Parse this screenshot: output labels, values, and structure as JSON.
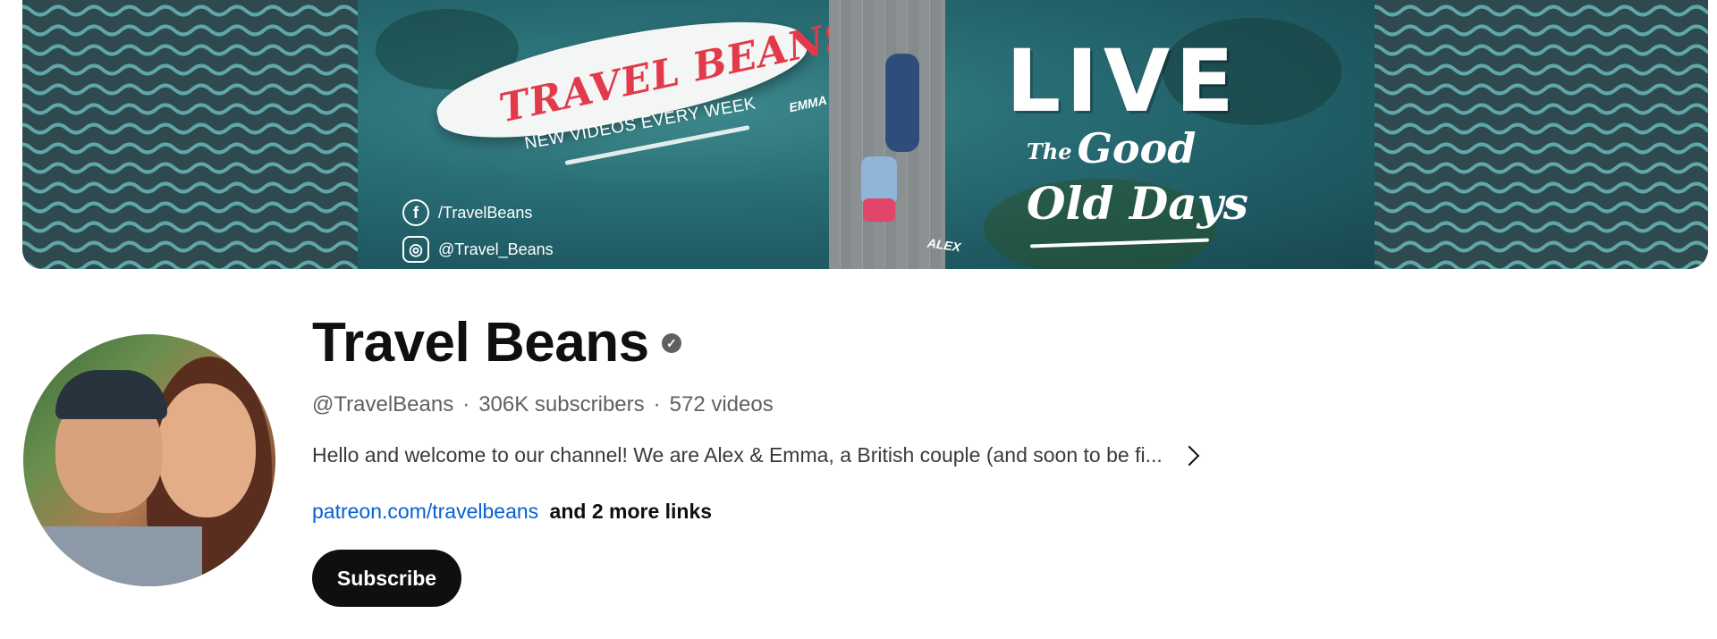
{
  "banner": {
    "title": "TRAVEL BEANS",
    "tagline": "NEW VIDEOS EVERY WEEK",
    "facebook": "/TravelBeans",
    "instagram": "@Travel_Beans",
    "label_emma": "EMMA",
    "label_alex": "ALEX",
    "slogan_big": "LIVE",
    "slogan_the": "The",
    "slogan_good": "Good",
    "slogan_line2": "Old Days",
    "colors": {
      "pattern": "#2e4a4f",
      "title_red": "#e23a4a",
      "water": "#2a6f76"
    }
  },
  "channel": {
    "name": "Travel Beans",
    "verified_icon": "verified-check-icon",
    "handle": "@TravelBeans",
    "subscribers": "306K subscribers",
    "videos": "572 videos",
    "separator": "·",
    "description": "Hello and welcome to our channel! We are Alex & Emma, a British couple (and soon to be fi...",
    "link": "patreon.com/travelbeans",
    "more_links": "and 2 more links",
    "subscribe_label": "Subscribe"
  }
}
